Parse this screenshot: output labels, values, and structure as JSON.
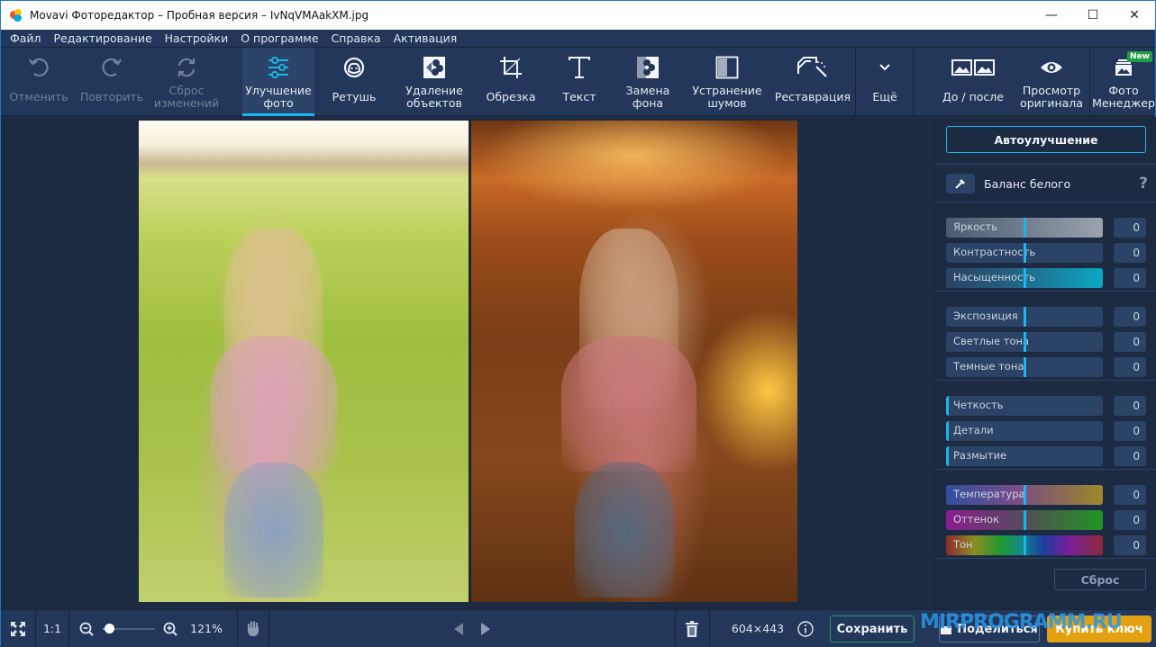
{
  "window": {
    "title": "Movavi Фоторедактор – Пробная версия – IvNqVMAakXM.jpg",
    "controls": {
      "minimize": "—",
      "maximize": "☐",
      "close": "✕"
    }
  },
  "menu": {
    "items": [
      "Файл",
      "Редактирование",
      "Настройки",
      "О программе",
      "Справка",
      "Активация"
    ]
  },
  "toolbar": {
    "undo": "Отменить",
    "redo": "Повторить",
    "reset_changes": "Сброс\nизменений",
    "enhance": "Улучшение\nфото",
    "retouch": "Ретушь",
    "remove_objects": "Удаление\nобъектов",
    "crop": "Обрезка",
    "text": "Текст",
    "replace_bg": "Замена\nфона",
    "denoise": "Устранение\nшумов",
    "restore": "Реставрация",
    "more": "Ещё",
    "before_after": "До / после",
    "view_original": "Просмотр\nоригинала",
    "photo_manager": "Фото\nМенеджер",
    "new_badge": "New",
    "active_tool": "enhance"
  },
  "panel": {
    "auto_enhance": "Автоулучшение",
    "white_balance": "Баланс белого",
    "help": "?",
    "groups": [
      {
        "sliders": [
          {
            "label": "Яркость",
            "value": "0",
            "position": 0.5,
            "style": "brightness"
          },
          {
            "label": "Контрастность",
            "value": "0",
            "position": 0.5,
            "style": "plain"
          },
          {
            "label": "Насыщенность",
            "value": "0",
            "position": 0.5,
            "style": "saturation"
          }
        ]
      },
      {
        "sliders": [
          {
            "label": "Экспозиция",
            "value": "0",
            "position": 0.5,
            "style": "plain"
          },
          {
            "label": "Светлые тона",
            "value": "0",
            "position": 0.5,
            "style": "plain"
          },
          {
            "label": "Темные тона",
            "value": "0",
            "position": 0.5,
            "style": "plain"
          }
        ]
      },
      {
        "sliders": [
          {
            "label": "Четкость",
            "value": "0",
            "position": 0.0,
            "style": "plain"
          },
          {
            "label": "Детали",
            "value": "0",
            "position": 0.0,
            "style": "plain"
          },
          {
            "label": "Размытие",
            "value": "0",
            "position": 0.0,
            "style": "plain"
          }
        ]
      },
      {
        "sliders": [
          {
            "label": "Температура",
            "value": "0",
            "position": 0.5,
            "style": "temperature"
          },
          {
            "label": "Оттенок",
            "value": "0",
            "position": 0.5,
            "style": "tint"
          },
          {
            "label": "Тон",
            "value": "0",
            "position": 0.5,
            "style": "hue"
          }
        ]
      }
    ],
    "reset": "Сброс"
  },
  "bottom": {
    "ratio_label": "1:1",
    "zoom_percent": "121%",
    "zoom_level": 0.12,
    "image_size": "604×443",
    "save": "Сохранить",
    "share": "Поделиться",
    "buy": "Купить ключ",
    "watermark": "MIRPROGRAMM.RU"
  },
  "colors": {
    "accent": "#1ab6ef",
    "background": "#1c2b42",
    "toolbar": "#22375a",
    "save_border": "#1e9d6a",
    "buy": "#e3a010",
    "new_badge": "#1e9d46"
  }
}
